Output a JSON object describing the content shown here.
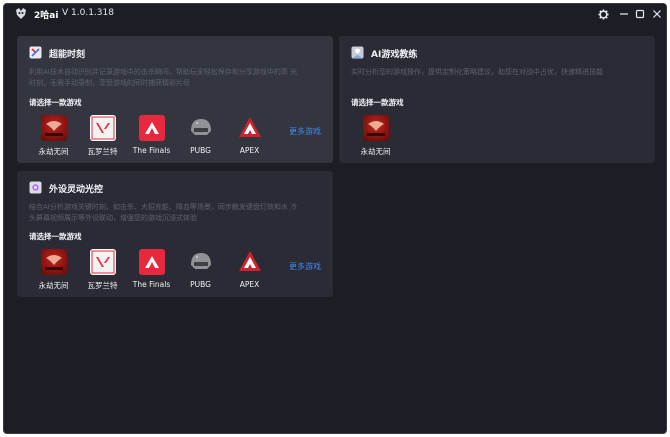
{
  "app": {
    "name": "2哈ai",
    "version": "V 1.0.1.318"
  },
  "colors": {
    "background": "#1c1d25",
    "card": "#2a2b35",
    "card_active": "#33353f",
    "link": "#3b8cf5"
  },
  "titlebar_icons": [
    "gear-icon",
    "minimize-icon",
    "maximize-icon",
    "close-icon"
  ],
  "cards": {
    "highlight": {
      "title": "超能时刻",
      "desc_line1": "利用AI技术自动识别并记录游戏中的击杀瞬间，帮助玩家轻松保存和分享游戏中的高 光",
      "desc_line2": "时刻，无需手动录制，享受游戏的同时捕获精彩片段",
      "prompt": "请选择一款游戏",
      "games": [
        "永劫无间",
        "瓦罗兰特",
        "The Finals",
        "PUBG",
        "APEX"
      ],
      "more": "更多游戏"
    },
    "coach": {
      "title": "AI游戏教练",
      "desc_line1": "实时分析您的游戏操作，提供定制化策略建议，助您在对战中占优，快速精进技能",
      "prompt": "请选择一款游戏",
      "games": [
        "永劫无间"
      ]
    },
    "lighting": {
      "title": "外设灵动光控",
      "desc_line1": "结合AI分析游戏关键时刻，如击杀、大招充能、障血等场景，同步触发键盘灯效和水 冷",
      "desc_line2": "头屏幕视频展示等外设联动，增强您的游戏沉浸式体验",
      "prompt": "请选择一款游戏",
      "games": [
        "永劫无间",
        "瓦罗兰特",
        "The Finals",
        "PUBG",
        "APEX"
      ],
      "more": "更多游戏"
    }
  }
}
